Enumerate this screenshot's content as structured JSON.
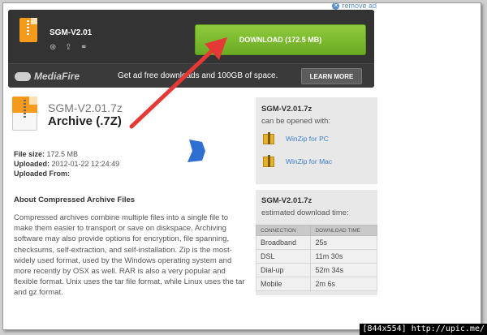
{
  "header": {
    "remove_ad": "remove ad"
  },
  "banner": {
    "filename": "SGM-V2.01",
    "download_label": "DOWNLOAD (172.5 MB)",
    "brand": "MediaFire",
    "ad_text": "Get ad free downloads and 100GB of space.",
    "learn_more": "LEARN MORE"
  },
  "file": {
    "name": "SGM-V2.01.7z",
    "type": "Archive (.7Z)",
    "size_label": "File size:",
    "size_value": "172.5 MB",
    "uploaded_label": "Uploaded:",
    "uploaded_value": "2012-01-22 12:24:49",
    "uploaded_from_label": "Uploaded From:"
  },
  "about": {
    "title": "About Compressed Archive Files",
    "body": "Compressed archives combine multiple files into a single file to make them easier to transport or save on diskspace. Archiving software may also provide options for encryption, file spanning, checksums, self-extraction, and self-installation. Zip is the most-widely used format, used by the Windows operating system and more recently by OSX as well. RAR is also a very popular and flexible format. Unix uses the tar file format, while Linux uses the tar and gz format."
  },
  "open_with": {
    "title": "SGM-V2.01.7z",
    "subtitle": "can be opened with:",
    "apps": [
      {
        "label": "WinZip for PC"
      },
      {
        "label": "WinZip for Mac"
      }
    ]
  },
  "download_time": {
    "title": "SGM-V2.01.7z",
    "subtitle": "estimated download time:",
    "columns": [
      "CONNECTION",
      "DOWNLOAD TIME"
    ],
    "rows": [
      [
        "Broadband",
        "25s"
      ],
      [
        "DSL",
        "11m 30s"
      ],
      [
        "Dial-up",
        "52m 34s"
      ],
      [
        "Mobile",
        "2m 6s"
      ]
    ]
  },
  "footer": {
    "caption": "[844x554] http://upic.me/"
  },
  "colors": {
    "accent_green": "#7abc2e",
    "arrow_red": "#e53935",
    "link_blue": "#3f7fc6"
  }
}
